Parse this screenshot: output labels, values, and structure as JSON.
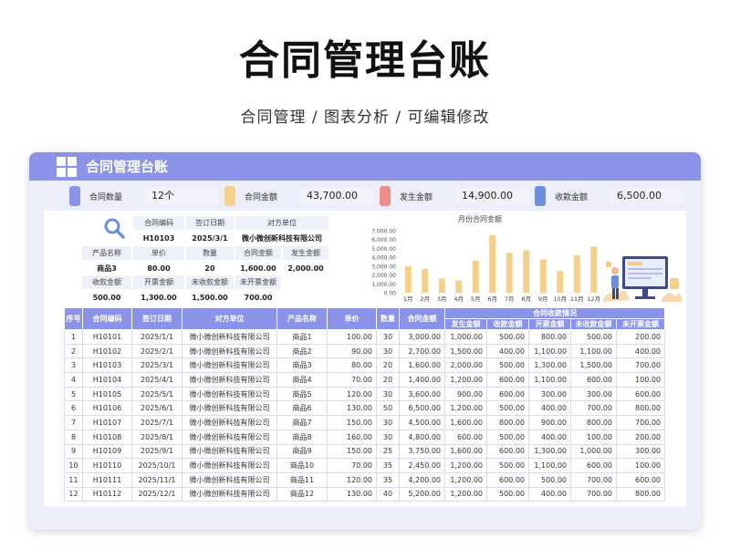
{
  "page": {
    "title": "合同管理台账",
    "subtitle": "合同管理 / 图表分析 / 可编辑修改"
  },
  "card": {
    "header_title": "合同管理台账",
    "header_icon": "calculator-icon"
  },
  "stats": [
    {
      "label": "合同数量",
      "value": "12个",
      "color": "#8b93e8"
    },
    {
      "label": "合同金额",
      "value": "43,700.00",
      "color": "#f5d08b"
    },
    {
      "label": "发生金额",
      "value": "14,900.00",
      "color": "#ee8d86"
    },
    {
      "label": "收款金额",
      "value": "6,500.00",
      "color": "#6b8fd8"
    }
  ],
  "lookup": {
    "row1_headers": [
      "合同编码",
      "签订日期",
      "对方单位"
    ],
    "row1_values": [
      "H10103",
      "2025/3/1",
      "微小微创新科技有限公司"
    ],
    "row2_headers": [
      "产品名称",
      "单价",
      "数量",
      "合同金额",
      "发生金额"
    ],
    "row2_values": [
      "商品3",
      "80.00",
      "20",
      "1,600.00",
      "2,000.00"
    ],
    "row3_headers": [
      "收款金额",
      "开票金额",
      "未收款金额",
      "未开票金额"
    ],
    "row3_values": [
      "500.00",
      "1,300.00",
      "1,500.00",
      "700.00"
    ]
  },
  "chart_data": {
    "type": "bar",
    "title": "月份合同金额",
    "categories": [
      "1月",
      "2月",
      "3月",
      "4月",
      "5月",
      "6月",
      "7月",
      "8月",
      "9月",
      "10月",
      "11月",
      "12月"
    ],
    "values": [
      3000,
      2700,
      1600,
      1400,
      3600,
      6500,
      4500,
      4800,
      3750,
      2450,
      4200,
      5200
    ],
    "yticks": [
      "0.00",
      "1,000.00",
      "2,000.00",
      "3,000.00",
      "4,000.00",
      "5,000.00",
      "6,000.00",
      "7,000.00"
    ],
    "ylim": [
      0,
      7000
    ],
    "bar_color": "#f5d08b",
    "grid": false
  },
  "table": {
    "headers": [
      "序号",
      "合同编码",
      "签订日期",
      "对方单位",
      "产品名称",
      "单价",
      "数量",
      "合同金额"
    ],
    "group_header": "合同收款情况",
    "sub_headers": [
      "发生金额",
      "收款金额",
      "开票金额",
      "未收款金额",
      "未开票金额"
    ],
    "rows": [
      [
        "1",
        "H10101",
        "2025/1/1",
        "微小微创新科技有限公司",
        "商品1",
        "100.00",
        "30",
        "3,000.00",
        "1,000.00",
        "500.00",
        "800.00",
        "500.00",
        "200.00"
      ],
      [
        "2",
        "H10102",
        "2025/2/1",
        "微小微创新科技有限公司",
        "商品2",
        "90.00",
        "30",
        "2,700.00",
        "1,500.00",
        "400.00",
        "1,100.00",
        "1,100.00",
        "400.00"
      ],
      [
        "3",
        "H10103",
        "2025/3/1",
        "微小微创新科技有限公司",
        "商品3",
        "80.00",
        "20",
        "1,600.00",
        "2,000.00",
        "500.00",
        "1,300.00",
        "1,500.00",
        "700.00"
      ],
      [
        "4",
        "H10104",
        "2025/4/1",
        "微小微创新科技有限公司",
        "商品4",
        "70.00",
        "20",
        "1,400.00",
        "1,200.00",
        "600.00",
        "1,100.00",
        "600.00",
        "100.00"
      ],
      [
        "5",
        "H10105",
        "2025/5/1",
        "微小微创新科技有限公司",
        "商品5",
        "120.00",
        "30",
        "3,600.00",
        "900.00",
        "600.00",
        "300.00",
        "300.00",
        "600.00"
      ],
      [
        "6",
        "H10106",
        "2025/6/1",
        "微小微创新科技有限公司",
        "商品6",
        "130.00",
        "50",
        "6,500.00",
        "1,200.00",
        "500.00",
        "400.00",
        "700.00",
        "800.00"
      ],
      [
        "7",
        "H10107",
        "2025/7/1",
        "微小微创新科技有限公司",
        "商品7",
        "150.00",
        "30",
        "4,500.00",
        "1,600.00",
        "800.00",
        "900.00",
        "800.00",
        "700.00"
      ],
      [
        "8",
        "H10108",
        "2025/8/1",
        "微小微创新科技有限公司",
        "商品8",
        "160.00",
        "30",
        "4,800.00",
        "600.00",
        "500.00",
        "400.00",
        "100.00",
        "200.00"
      ],
      [
        "9",
        "H10109",
        "2025/9/1",
        "微小微创新科技有限公司",
        "商品9",
        "150.00",
        "25",
        "3,750.00",
        "1,600.00",
        "600.00",
        "1,300.00",
        "1,000.00",
        "300.00"
      ],
      [
        "10",
        "H10110",
        "2025/10/1",
        "微小微创新科技有限公司",
        "商品10",
        "70.00",
        "35",
        "2,450.00",
        "1,200.00",
        "500.00",
        "1,100.00",
        "600.00",
        "100.00"
      ],
      [
        "11",
        "H10111",
        "2025/11/1",
        "微小微创新科技有限公司",
        "商品11",
        "120.00",
        "35",
        "4,200.00",
        "1,200.00",
        "600.00",
        "500.00",
        "700.00",
        "600.00"
      ],
      [
        "12",
        "H10112",
        "2025/12/1",
        "微小微创新科技有限公司",
        "商品12",
        "130.00",
        "40",
        "5,200.00",
        "1,200.00",
        "500.00",
        "400.00",
        "700.00",
        "800.00"
      ]
    ]
  }
}
